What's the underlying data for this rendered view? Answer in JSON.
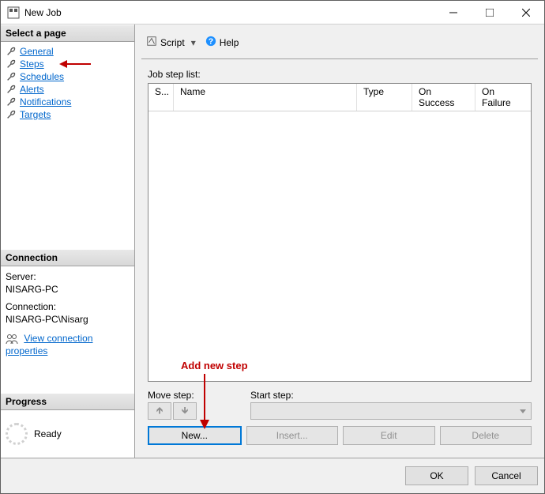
{
  "titlebar": {
    "title": "New Job"
  },
  "sidebar": {
    "select_page_header": "Select a page",
    "pages": [
      {
        "label": "General"
      },
      {
        "label": "Steps"
      },
      {
        "label": "Schedules"
      },
      {
        "label": "Alerts"
      },
      {
        "label": "Notifications"
      },
      {
        "label": "Targets"
      }
    ],
    "connection_header": "Connection",
    "server_label": "Server:",
    "server_value": "NISARG-PC",
    "connection_label": "Connection:",
    "connection_value": "NISARG-PC\\Nisarg",
    "view_conn_link": "View connection properties",
    "progress_header": "Progress",
    "progress_status": "Ready"
  },
  "toolbar": {
    "script_label": "Script",
    "help_label": "Help"
  },
  "main": {
    "list_label": "Job step list:",
    "columns": {
      "s": "S...",
      "name": "Name",
      "type": "Type",
      "on_success": "On Success",
      "on_failure": "On Failure"
    },
    "move_label": "Move step:",
    "start_label": "Start step:",
    "new_btn": "New...",
    "insert_btn": "Insert...",
    "edit_btn": "Edit",
    "delete_btn": "Delete"
  },
  "footer": {
    "ok": "OK",
    "cancel": "Cancel"
  },
  "annotations": {
    "add_new_step": "Add new step"
  }
}
